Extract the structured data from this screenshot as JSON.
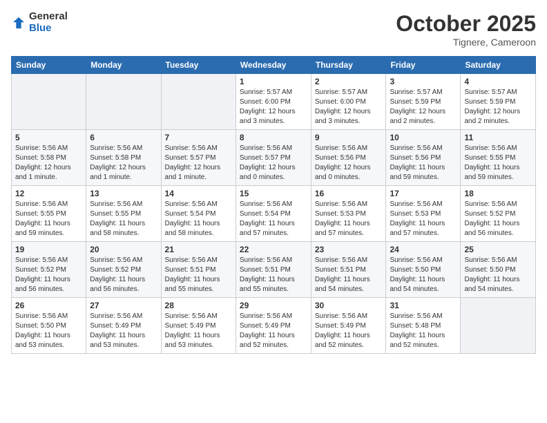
{
  "header": {
    "logo_general": "General",
    "logo_blue": "Blue",
    "month": "October 2025",
    "location": "Tignere, Cameroon"
  },
  "days_of_week": [
    "Sunday",
    "Monday",
    "Tuesday",
    "Wednesday",
    "Thursday",
    "Friday",
    "Saturday"
  ],
  "weeks": [
    [
      {
        "day": "",
        "info": ""
      },
      {
        "day": "",
        "info": ""
      },
      {
        "day": "",
        "info": ""
      },
      {
        "day": "1",
        "info": "Sunrise: 5:57 AM\nSunset: 6:00 PM\nDaylight: 12 hours\nand 3 minutes."
      },
      {
        "day": "2",
        "info": "Sunrise: 5:57 AM\nSunset: 6:00 PM\nDaylight: 12 hours\nand 3 minutes."
      },
      {
        "day": "3",
        "info": "Sunrise: 5:57 AM\nSunset: 5:59 PM\nDaylight: 12 hours\nand 2 minutes."
      },
      {
        "day": "4",
        "info": "Sunrise: 5:57 AM\nSunset: 5:59 PM\nDaylight: 12 hours\nand 2 minutes."
      }
    ],
    [
      {
        "day": "5",
        "info": "Sunrise: 5:56 AM\nSunset: 5:58 PM\nDaylight: 12 hours\nand 1 minute."
      },
      {
        "day": "6",
        "info": "Sunrise: 5:56 AM\nSunset: 5:58 PM\nDaylight: 12 hours\nand 1 minute."
      },
      {
        "day": "7",
        "info": "Sunrise: 5:56 AM\nSunset: 5:57 PM\nDaylight: 12 hours\nand 1 minute."
      },
      {
        "day": "8",
        "info": "Sunrise: 5:56 AM\nSunset: 5:57 PM\nDaylight: 12 hours\nand 0 minutes."
      },
      {
        "day": "9",
        "info": "Sunrise: 5:56 AM\nSunset: 5:56 PM\nDaylight: 12 hours\nand 0 minutes."
      },
      {
        "day": "10",
        "info": "Sunrise: 5:56 AM\nSunset: 5:56 PM\nDaylight: 11 hours\nand 59 minutes."
      },
      {
        "day": "11",
        "info": "Sunrise: 5:56 AM\nSunset: 5:55 PM\nDaylight: 11 hours\nand 59 minutes."
      }
    ],
    [
      {
        "day": "12",
        "info": "Sunrise: 5:56 AM\nSunset: 5:55 PM\nDaylight: 11 hours\nand 59 minutes."
      },
      {
        "day": "13",
        "info": "Sunrise: 5:56 AM\nSunset: 5:55 PM\nDaylight: 11 hours\nand 58 minutes."
      },
      {
        "day": "14",
        "info": "Sunrise: 5:56 AM\nSunset: 5:54 PM\nDaylight: 11 hours\nand 58 minutes."
      },
      {
        "day": "15",
        "info": "Sunrise: 5:56 AM\nSunset: 5:54 PM\nDaylight: 11 hours\nand 57 minutes."
      },
      {
        "day": "16",
        "info": "Sunrise: 5:56 AM\nSunset: 5:53 PM\nDaylight: 11 hours\nand 57 minutes."
      },
      {
        "day": "17",
        "info": "Sunrise: 5:56 AM\nSunset: 5:53 PM\nDaylight: 11 hours\nand 57 minutes."
      },
      {
        "day": "18",
        "info": "Sunrise: 5:56 AM\nSunset: 5:52 PM\nDaylight: 11 hours\nand 56 minutes."
      }
    ],
    [
      {
        "day": "19",
        "info": "Sunrise: 5:56 AM\nSunset: 5:52 PM\nDaylight: 11 hours\nand 56 minutes."
      },
      {
        "day": "20",
        "info": "Sunrise: 5:56 AM\nSunset: 5:52 PM\nDaylight: 11 hours\nand 56 minutes."
      },
      {
        "day": "21",
        "info": "Sunrise: 5:56 AM\nSunset: 5:51 PM\nDaylight: 11 hours\nand 55 minutes."
      },
      {
        "day": "22",
        "info": "Sunrise: 5:56 AM\nSunset: 5:51 PM\nDaylight: 11 hours\nand 55 minutes."
      },
      {
        "day": "23",
        "info": "Sunrise: 5:56 AM\nSunset: 5:51 PM\nDaylight: 11 hours\nand 54 minutes."
      },
      {
        "day": "24",
        "info": "Sunrise: 5:56 AM\nSunset: 5:50 PM\nDaylight: 11 hours\nand 54 minutes."
      },
      {
        "day": "25",
        "info": "Sunrise: 5:56 AM\nSunset: 5:50 PM\nDaylight: 11 hours\nand 54 minutes."
      }
    ],
    [
      {
        "day": "26",
        "info": "Sunrise: 5:56 AM\nSunset: 5:50 PM\nDaylight: 11 hours\nand 53 minutes."
      },
      {
        "day": "27",
        "info": "Sunrise: 5:56 AM\nSunset: 5:49 PM\nDaylight: 11 hours\nand 53 minutes."
      },
      {
        "day": "28",
        "info": "Sunrise: 5:56 AM\nSunset: 5:49 PM\nDaylight: 11 hours\nand 53 minutes."
      },
      {
        "day": "29",
        "info": "Sunrise: 5:56 AM\nSunset: 5:49 PM\nDaylight: 11 hours\nand 52 minutes."
      },
      {
        "day": "30",
        "info": "Sunrise: 5:56 AM\nSunset: 5:49 PM\nDaylight: 11 hours\nand 52 minutes."
      },
      {
        "day": "31",
        "info": "Sunrise: 5:56 AM\nSunset: 5:48 PM\nDaylight: 11 hours\nand 52 minutes."
      },
      {
        "day": "",
        "info": ""
      }
    ]
  ]
}
